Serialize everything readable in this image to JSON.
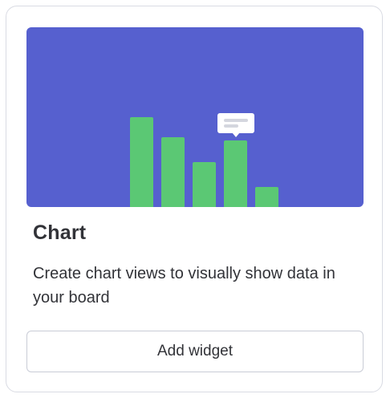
{
  "widget": {
    "title": "Chart",
    "description": "Create chart views to visually show data in your board",
    "add_button_label": "Add widget"
  },
  "illustration": {
    "icon": "bar-chart-illustration",
    "background_color": "#5660cf",
    "bar_color": "#5bc874",
    "tooltip_color": "#ffffff",
    "bar_levels": [
      0.5,
      0.39,
      0.25,
      0.37,
      0.11
    ]
  },
  "colors": {
    "card_border": "#d9dbe3",
    "text": "#323338",
    "button_border": "#c9ccd6"
  }
}
